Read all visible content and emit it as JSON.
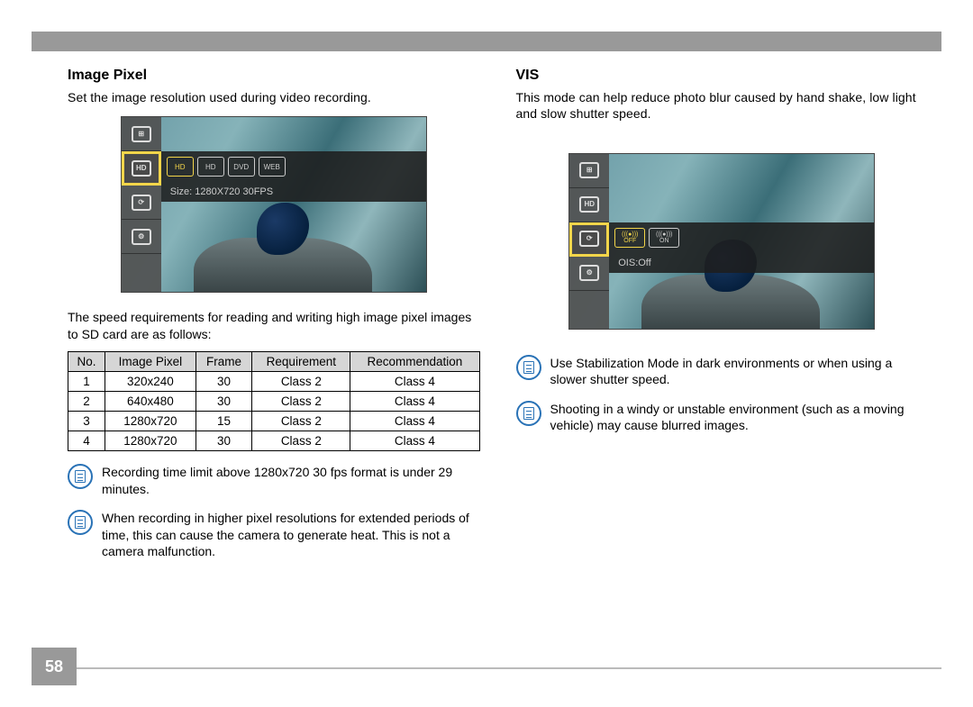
{
  "page_number": "58",
  "left": {
    "title": "Image Pixel",
    "desc": "Set the image resolution used during video recording.",
    "screen": {
      "sidebar": [
        "⊞",
        "HD",
        "⟳",
        "⚙"
      ],
      "sidebar_selected": 1,
      "options": [
        "HD",
        "HD",
        "DVD",
        "WEB"
      ],
      "option_selected": 0,
      "caption": "Size: 1280X720 30FPS"
    },
    "subdesc": "The speed requirements for reading and writing high image pixel images to SD card are as follows:",
    "table": {
      "headers": [
        "No.",
        "Image Pixel",
        "Frame",
        "Requirement",
        "Recommendation"
      ],
      "rows": [
        [
          "1",
          "320x240",
          "30",
          "Class 2",
          "Class 4"
        ],
        [
          "2",
          "640x480",
          "30",
          "Class 2",
          "Class 4"
        ],
        [
          "3",
          "1280x720",
          "15",
          "Class 2",
          "Class 4"
        ],
        [
          "4",
          "1280x720",
          "30",
          "Class 2",
          "Class 4"
        ]
      ]
    },
    "notes": [
      "Recording time limit above 1280x720 30 fps format is under 29 minutes.",
      "When recording in higher pixel resolutions for extended periods of time, this can cause the camera to generate heat. This is not a camera malfunction."
    ]
  },
  "right": {
    "title": "VIS",
    "desc": "This mode can help reduce photo blur caused by hand shake, low light and slow shutter speed.",
    "screen": {
      "sidebar": [
        "⊞",
        "HD",
        "⟳",
        "⚙"
      ],
      "sidebar_selected": 2,
      "options": [
        "OFF",
        "ON"
      ],
      "option_selected": 0,
      "caption": "OIS:Off"
    },
    "notes": [
      "Use Stabilization Mode in dark environments or when using a slower shutter speed.",
      "Shooting in a windy or unstable environment (such as a moving vehicle) may cause blurred images."
    ]
  }
}
